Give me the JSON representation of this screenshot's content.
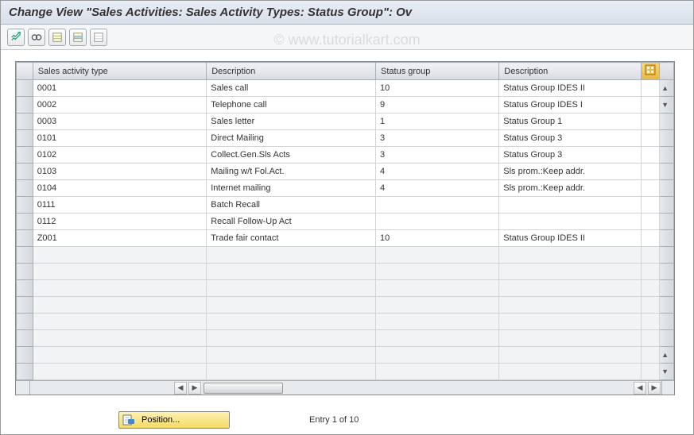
{
  "title": "Change View \"Sales Activities: Sales Activity Types: Status Group\": Ov",
  "watermark": "© www.tutorialkart.com",
  "toolbar": {
    "buttons": [
      "change",
      "glasses",
      "list1",
      "list2",
      "list3"
    ]
  },
  "columns": {
    "type": "Sales activity type",
    "desc": "Description",
    "sg": "Status group",
    "desc2": "Description"
  },
  "rows": [
    {
      "type": "0001",
      "desc": "Sales call",
      "sg": "10",
      "desc2": "Status Group IDES II"
    },
    {
      "type": "0002",
      "desc": "Telephone call",
      "sg": "9",
      "desc2": "Status Group IDES I"
    },
    {
      "type": "0003",
      "desc": "Sales letter",
      "sg": "1",
      "desc2": "Status Group 1"
    },
    {
      "type": "0101",
      "desc": "Direct Mailing",
      "sg": "3",
      "desc2": "Status Group 3"
    },
    {
      "type": "0102",
      "desc": "Collect.Gen.Sls Acts",
      "sg": "3",
      "desc2": "Status Group 3"
    },
    {
      "type": "0103",
      "desc": "Mailing w/t Fol.Act.",
      "sg": "4",
      "desc2": "Sls prom.:Keep addr."
    },
    {
      "type": "0104",
      "desc": "Internet mailing",
      "sg": "4",
      "desc2": "Sls prom.:Keep addr."
    },
    {
      "type": "0111",
      "desc": "Batch Recall",
      "sg": "",
      "desc2": ""
    },
    {
      "type": "0112",
      "desc": "Recall Follow-Up Act",
      "sg": "",
      "desc2": ""
    },
    {
      "type": "Z001",
      "desc": "Trade fair contact",
      "sg": "10",
      "desc2": "Status Group IDES II"
    }
  ],
  "emptyRows": 8,
  "footer": {
    "positionLabel": "Position...",
    "entryText": "Entry 1 of 10"
  }
}
